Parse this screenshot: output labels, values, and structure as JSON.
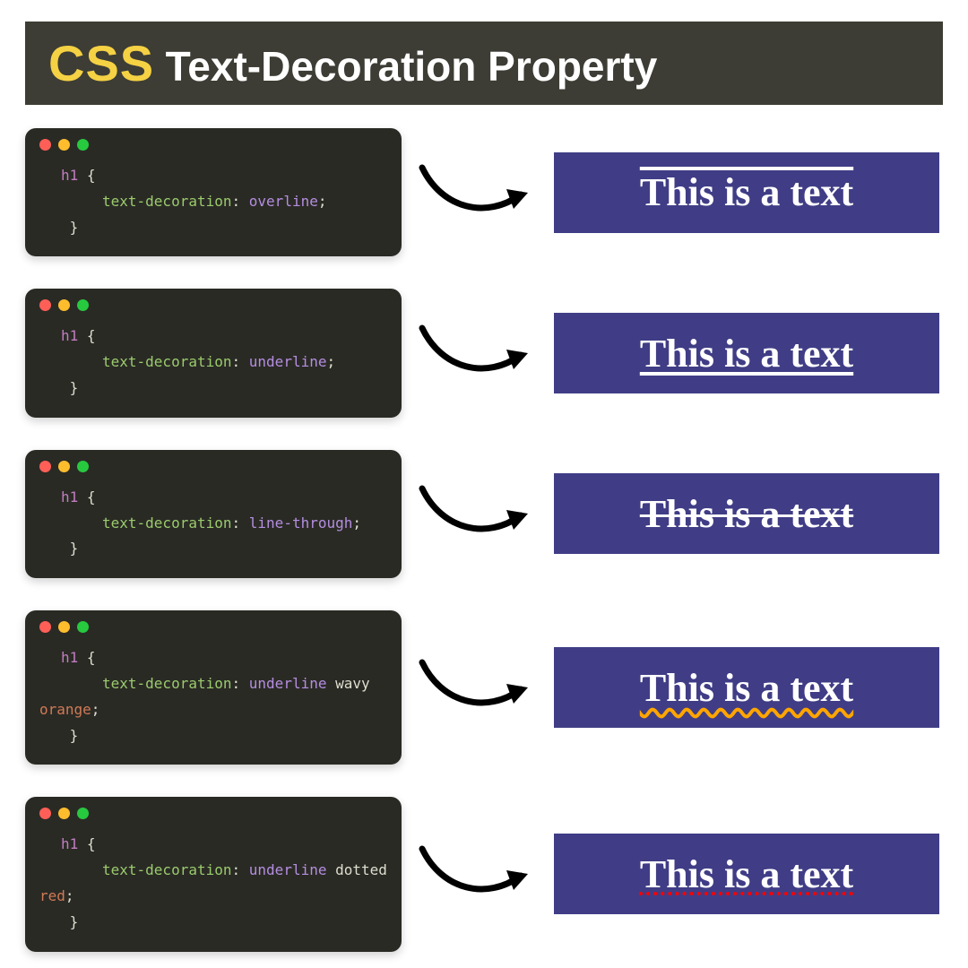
{
  "header": {
    "css_label": "CSS",
    "rest_label": "Text-Decoration Property"
  },
  "code_common": {
    "selector": "h1",
    "open_brace": "{",
    "close_brace": "}",
    "property": "text-decoration",
    "colon": ":"
  },
  "examples": [
    {
      "value_tokens": [
        {
          "text": "overline",
          "cls": "tok-val1"
        }
      ],
      "semicolon": ";",
      "preview_text": "This is a text",
      "style": "text-decoration: overline; text-decoration-thickness:4px;"
    },
    {
      "value_tokens": [
        {
          "text": "underline",
          "cls": "tok-val1"
        }
      ],
      "semicolon": ";",
      "preview_text": "This is a text",
      "style": "text-decoration: underline; text-decoration-thickness:4px;"
    },
    {
      "value_tokens": [
        {
          "text": "line-through",
          "cls": "tok-val1"
        }
      ],
      "semicolon": ";",
      "preview_text": "This is a text",
      "style": "text-decoration: line-through; text-decoration-thickness:3px;"
    },
    {
      "value_tokens": [
        {
          "text": "underline",
          "cls": "tok-val1"
        },
        {
          "text": "wavy",
          "cls": "tok-val2"
        },
        {
          "text": "orange",
          "cls": "tok-val3"
        }
      ],
      "semicolon": ";",
      "preview_text": "This is a text",
      "style": "text-decoration: underline wavy orange; text-decoration-thickness:4px; text-underline-offset:8px;"
    },
    {
      "value_tokens": [
        {
          "text": "underline",
          "cls": "tok-val1"
        },
        {
          "text": "dotted",
          "cls": "tok-val2"
        },
        {
          "text": "red",
          "cls": "tok-val3"
        }
      ],
      "semicolon": ";",
      "preview_text": "This is a text",
      "style": "text-decoration: underline dotted red; text-decoration-thickness:4px; text-underline-offset:6px;"
    }
  ]
}
